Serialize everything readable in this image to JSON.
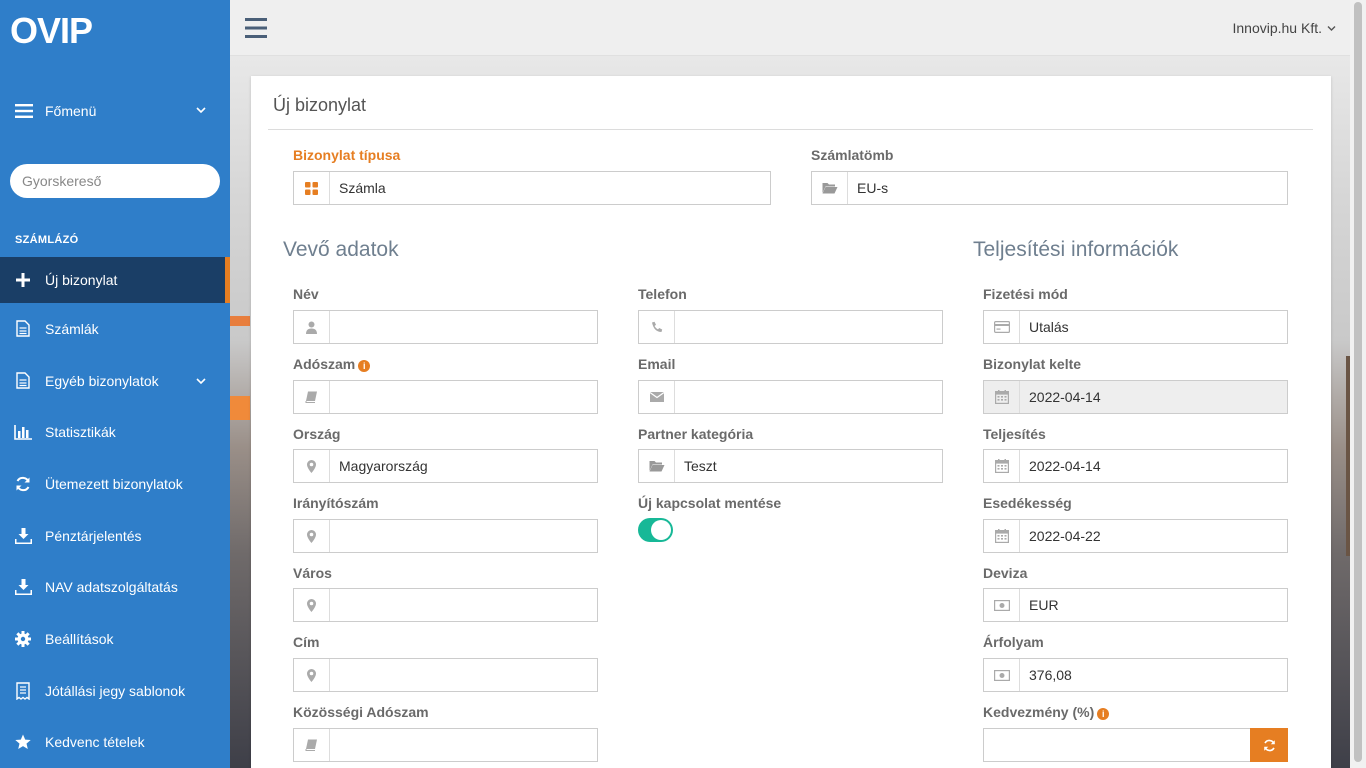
{
  "sidebar": {
    "logo_text": "OVIP",
    "main_menu_label": "Főmenü",
    "search_placeholder": "Gyorskereső",
    "section_title": "SZÁMLÁZÓ",
    "items": [
      {
        "label": "Új bizonylat",
        "icon": "plus-icon",
        "active": true
      },
      {
        "label": "Számlák",
        "icon": "document-icon"
      },
      {
        "label": "Egyéb bizonylatok",
        "icon": "document-icon",
        "has_submenu": true
      },
      {
        "label": "Statisztikák",
        "icon": "bar-chart-icon"
      },
      {
        "label": "Ütemezett bizonylatok",
        "icon": "refresh-icon"
      },
      {
        "label": "Pénztárjelentés",
        "icon": "download-icon"
      },
      {
        "label": "NAV adatszolgáltatás",
        "icon": "download-icon"
      },
      {
        "label": "Beállítások",
        "icon": "gear-icon"
      },
      {
        "label": "Jótállási jegy sablonok",
        "icon": "receipt-icon"
      },
      {
        "label": "Kedvenc tételek",
        "icon": "star-icon"
      }
    ]
  },
  "topbar": {
    "company": "Innovip.hu Kft."
  },
  "panel": {
    "title": "Új bizonylat",
    "doc_type": {
      "label": "Bizonylat típusa",
      "value": "Számla",
      "icon": "grid-icon"
    },
    "invoice_block": {
      "label": "Számlatömb",
      "value": "EU-s",
      "icon": "folder-icon"
    },
    "buyer_title": "Vevő adatok",
    "fulfillment_title": "Teljesítési információk",
    "buyer_fields": {
      "name": {
        "label": "Név",
        "value": ""
      },
      "tax_number": {
        "label": "Adószam",
        "value": ""
      },
      "country": {
        "label": "Ország",
        "value": "Magyarország"
      },
      "zip": {
        "label": "Irányítószám",
        "value": ""
      },
      "city": {
        "label": "Város",
        "value": ""
      },
      "address": {
        "label": "Cím",
        "value": ""
      },
      "eu_tax_number": {
        "label": "Közösségi Adószam",
        "value": ""
      },
      "phone": {
        "label": "Telefon",
        "value": ""
      },
      "email": {
        "label": "Email",
        "value": ""
      },
      "partner_category": {
        "label": "Partner kategória",
        "value": "Teszt"
      },
      "save_contact": {
        "label": "Új kapcsolat mentése",
        "on": true
      }
    },
    "fulfillment_fields": {
      "payment_method": {
        "label": "Fizetési mód",
        "value": "Utalás"
      },
      "issue_date": {
        "label": "Bizonylat kelte",
        "value": "2022-04-14"
      },
      "fulfillment_date": {
        "label": "Teljesítés",
        "value": "2022-04-14"
      },
      "due_date": {
        "label": "Esedékesség",
        "value": "2022-04-22"
      },
      "currency": {
        "label": "Deviza",
        "value": "EUR"
      },
      "exchange_rate": {
        "label": "Árfolyam",
        "value": "376,08"
      },
      "discount": {
        "label": "Kedvezmény (%)",
        "value": ""
      }
    }
  },
  "colors": {
    "sidebar": "#2f7ec9",
    "sidebar_active": "#1a3e66",
    "accent": "#e67e22",
    "toggle": "#17b897"
  }
}
